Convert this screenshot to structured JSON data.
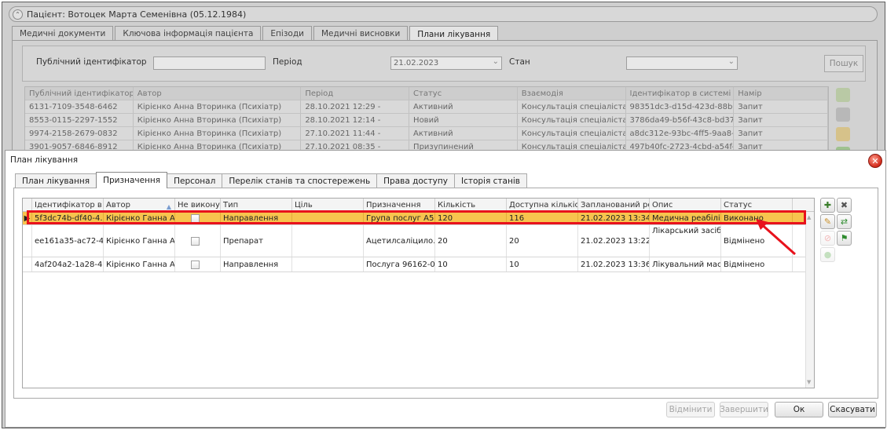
{
  "background": {
    "patient_title": "Пацієнт: Вотоцек Марта Семенівна (05.12.1984)",
    "tabs": [
      "Медичні документи",
      "Ключова інформація пацієнта",
      "Епізоди",
      "Медичні висновки",
      "Плани лікування"
    ],
    "active_tab": "Плани лікування",
    "filters": {
      "public_id_label": "Публічний ідентифікатор",
      "public_id_value": "",
      "period_label": "Період",
      "period_value": "21.02.2023",
      "state_label": "Стан",
      "state_value": "",
      "search_button": "Пошук"
    },
    "grid_columns": [
      "Публічний ідентифікатор",
      "Автор",
      "Період",
      "Статус",
      "Взаємодія",
      "Ідентифікатор в системі \"еНе",
      "Намір"
    ],
    "grid_rows": [
      [
        "6131-7109-3548-6462",
        "Кірієнко Анна Вторинка (Психіатр)",
        "28.10.2021 12:29 -",
        "Активний",
        "Консультація спеціаліста С...",
        "98351dc3-d15d-423d-88b0...",
        "Запит"
      ],
      [
        "8553-0115-2297-1552",
        "Кірієнко Анна Вторинка (Психіатр)",
        "28.10.2021 12:14 -",
        "Новий",
        "Консультація спеціаліста С...",
        "3786da49-b56f-43c8-bd37-...",
        "Запит"
      ],
      [
        "9974-2158-2679-0832",
        "Кірієнко Анна Вторинка (Психіатр)",
        "27.10.2021 11:44 -",
        "Активний",
        "Консультація спеціаліста С...",
        "a8dc312e-93bc-4ff5-9aa8-e...",
        "Запит"
      ],
      [
        "3901-9057-6846-8912",
        "Кірієнко Анна Вторинка (Психіатр)",
        "27.10.2021 08:35 -",
        "Призупинений",
        "Консультація спеціаліста С...",
        "497b40fc-2723-4cbd-a54f-b...",
        "Запит"
      ]
    ]
  },
  "dialog": {
    "title": "План лікування",
    "close_icon": "close-icon",
    "tabs": [
      "План лікування",
      "Призначення",
      "Персонал",
      "Перелік станів та спостережень",
      "Права доступу",
      "Історія станів"
    ],
    "active_tab": "Призначення",
    "columns": [
      "Ідентифікатор в си",
      "Автор",
      "Не виконує",
      "Тип",
      "Ціль",
      "Призначення",
      "Кількість",
      "Доступна кількість",
      "Запланований роз",
      "Опис",
      "Статус"
    ],
    "rows": [
      {
        "id": "5f3dc74b-df40-4...",
        "author": "Кірієнко Ганна А...",
        "not_done": false,
        "type": "Направлення",
        "goal": "",
        "assignment": "Група послуг А5...",
        "qty": "120",
        "available": "116",
        "planned": "21.02.2023 13:34 -",
        "desc": "Медична реабілі...",
        "status": "Виконано",
        "selected": true
      },
      {
        "id": "ee161a35-ac72-4...",
        "author": "Кірієнко Ганна А...",
        "not_done": false,
        "type": "Препарат",
        "goal": "",
        "assignment": "Ацетилсаліцило...",
        "qty": "20",
        "available": "20",
        "planned": "21.02.2023 13:22 -",
        "desc": "Лікарський засіб...",
        "status": "Відмінено",
        "selected": false
      },
      {
        "id": "4af204a2-1a28-4...",
        "author": "Кірієнко Ганна А...",
        "not_done": false,
        "type": "Направлення",
        "goal": "",
        "assignment": "Послуга 96162-0...",
        "qty": "10",
        "available": "10",
        "planned": "21.02.2023 13:36 -",
        "desc": "Лікувальний мас...",
        "status": "Відмінено",
        "selected": false
      }
    ],
    "footer": {
      "cancel_item": "Відмінити",
      "complete": "Завершити",
      "ok": "Ок",
      "cancel": "Скасувати"
    },
    "highlight_color": "#e8121c",
    "selected_row_color": "#f7c44e"
  }
}
